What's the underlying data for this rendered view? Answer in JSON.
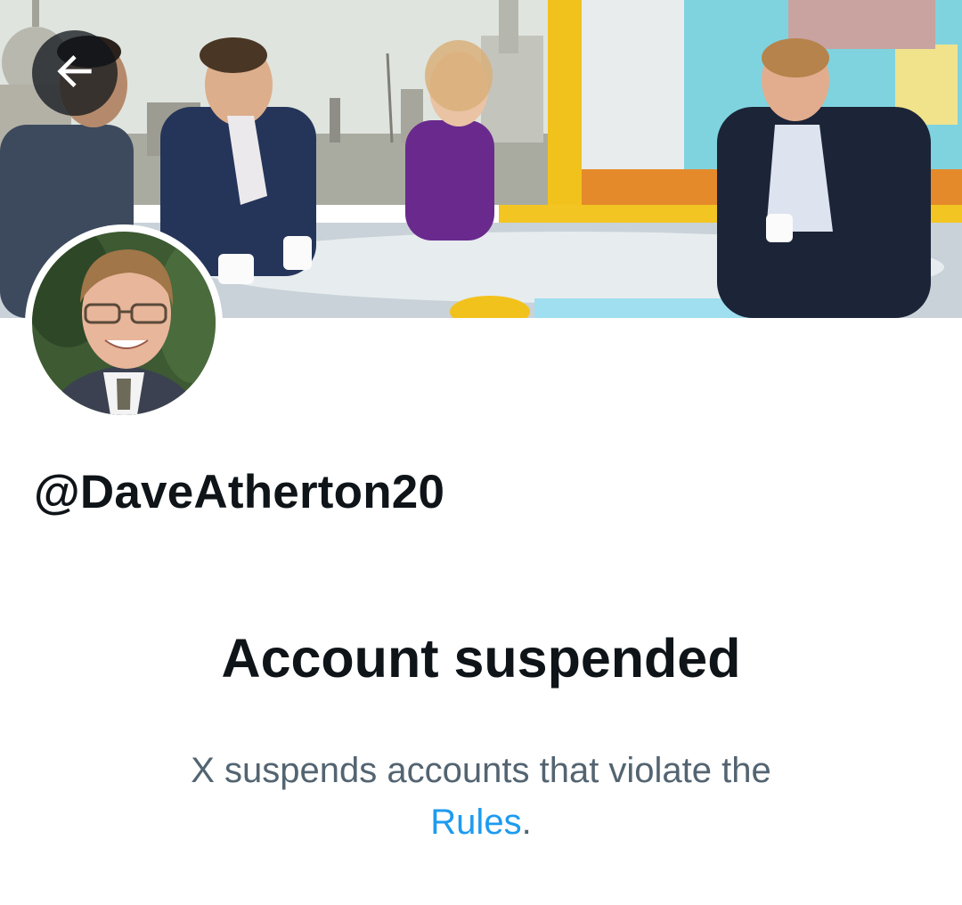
{
  "profile": {
    "handle": "@DaveAtherton20"
  },
  "notice": {
    "title": "Account suspended",
    "body_prefix": "X suspends accounts that violate the",
    "link_text": "Rules",
    "body_suffix": "."
  },
  "icons": {
    "back": "arrow-left-icon"
  },
  "colors": {
    "text_primary": "#0f1419",
    "text_secondary": "#536471",
    "link": "#1d9bf0"
  }
}
